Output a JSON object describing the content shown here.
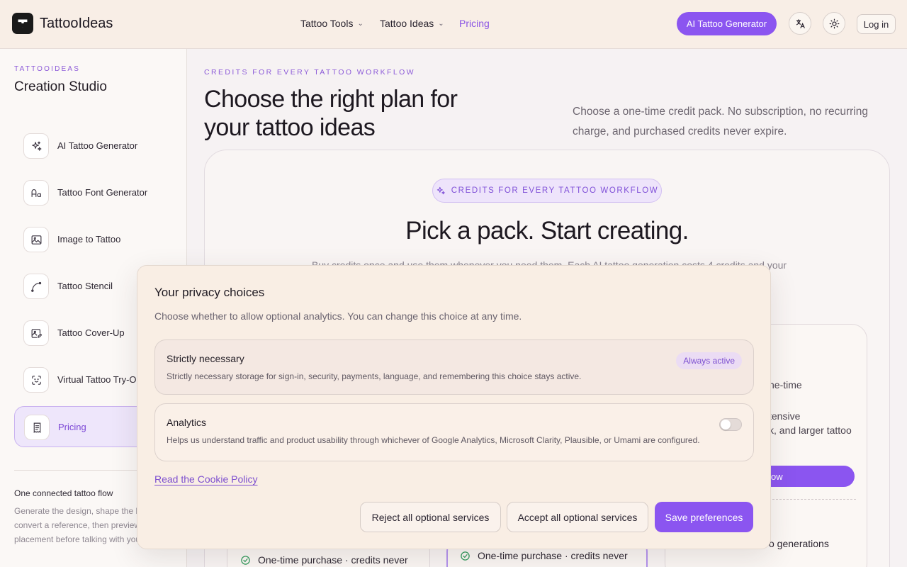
{
  "header": {
    "brand": "TattooIdeas",
    "nav": [
      {
        "label": "Tattoo Tools",
        "has_chevron": true
      },
      {
        "label": "Tattoo Ideas",
        "has_chevron": true
      },
      {
        "label": "Pricing",
        "active": true
      }
    ],
    "cta_label": "AI Tattoo Generator",
    "login_label": "Log in",
    "icons": [
      "translate-icon",
      "sun-icon"
    ]
  },
  "sidebar": {
    "eyebrow": "TATTOOIDEAS",
    "title": "Creation Studio",
    "items": [
      {
        "label": "AI Tattoo Generator",
        "icon": "sparkles-icon"
      },
      {
        "label": "Tattoo Font Generator",
        "icon": "font-icon"
      },
      {
        "label": "Image to Tattoo",
        "icon": "image-icon"
      },
      {
        "label": "Tattoo Stencil",
        "icon": "pen-curve-icon"
      },
      {
        "label": "Tattoo Cover-Up",
        "icon": "image-edit-icon"
      },
      {
        "label": "Virtual Tattoo Try-On",
        "icon": "scan-face-icon"
      },
      {
        "label": "Pricing",
        "icon": "receipt-icon",
        "active": true
      }
    ],
    "flow_title": "One connected tattoo flow",
    "flow_text": "Generate the design, shape the l convert a reference, then preview placement before talking with you"
  },
  "main": {
    "eyebrow": "CREDITS FOR EVERY TATTOO WORKFLOW",
    "title": "Choose the right plan for your tattoo ideas",
    "description": "Choose a one-time credit pack. No subscription, no recurring charge, and purchased credits never expire.",
    "pill": "CREDITS FOR EVERY TATTOO WORKFLOW",
    "pack_title": "Pick a pack. Start creating.",
    "pack_sub": "Buy credits once and use them whenever you need them. Each AI tattoo generation costs 4 credits and your",
    "right_card": {
      "line1": "ne-time",
      "line2a": "tensive",
      "line2b": "k, and larger tattoo",
      "button": "ow",
      "line3": "o generations"
    },
    "left_feature": "One-time purchase · credits never",
    "mid_feature": "One-time purchase · credits never"
  },
  "cookie_modal": {
    "title": "Your privacy choices",
    "description": "Choose whether to allow optional analytics. You can change this choice at any time.",
    "necessary": {
      "title": "Strictly necessary",
      "badge": "Always active",
      "description": "Strictly necessary storage for sign-in, security, payments, language, and remembering this choice stays active."
    },
    "analytics": {
      "title": "Analytics",
      "enabled": false,
      "description": "Helps us understand traffic and product usability through whichever of Google Analytics, Microsoft Clarity, Plausible, or Umami are configured."
    },
    "policy_link": "Read the Cookie Policy",
    "buttons": {
      "reject": "Reject all optional services",
      "accept": "Accept all optional services",
      "save": "Save preferences"
    }
  },
  "colors": {
    "accent": "#8b55f0",
    "header_bg": "#f8eee6",
    "modal_bg": "#f9eee4"
  }
}
